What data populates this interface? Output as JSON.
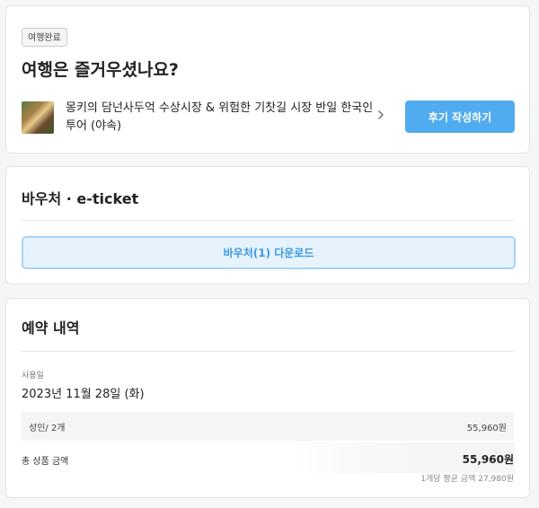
{
  "trip_card": {
    "badge": "여행완료",
    "title": "여행은 즐거우셨나요?",
    "tour_name": "몽키의 담넌사두억 수상시장 & 위험한 기찻길 시장 반일 한국인 투어 (야속)",
    "review_button": "후기 작성하기",
    "thumbnail_icon": "tour-thumbnail",
    "chevron_icon": "chevron-right-icon"
  },
  "voucher_card": {
    "title": "바우처  ·  e-ticket",
    "download_button": "바우처(1) 다운로드"
  },
  "booking_card": {
    "title": "예약 내역",
    "use_date_label": "사용일",
    "use_date": "2023년 11월 28일 (화)",
    "line_item_label": "성인/ 2개",
    "line_item_price": "55,960원",
    "total_label": "총 상품 금액",
    "total_amount": "55,960원",
    "avg_note": "1개당 평균 금액 27,980원"
  },
  "colors": {
    "accent": "#51abef",
    "download_bg": "#e6f3fd",
    "download_text": "#3c98e1"
  }
}
